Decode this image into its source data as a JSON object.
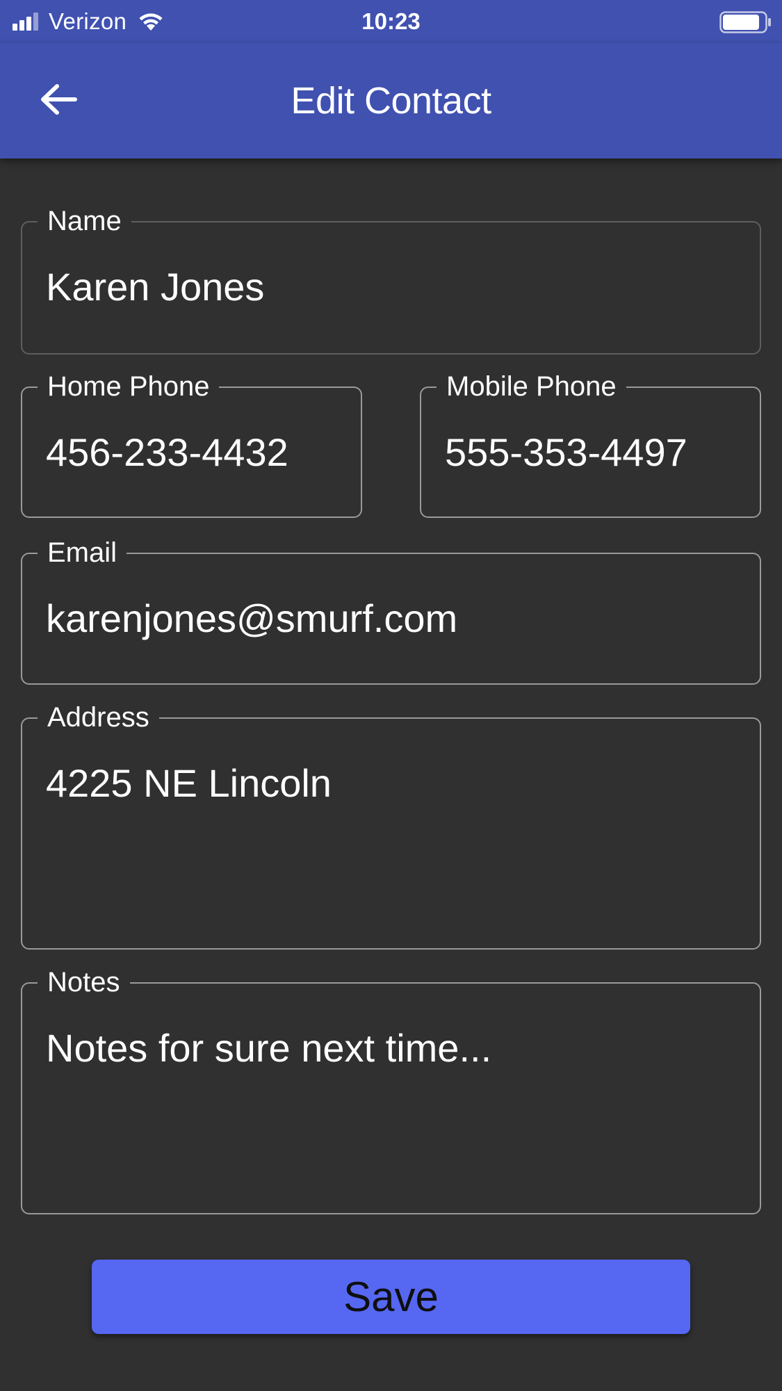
{
  "status_bar": {
    "carrier": "Verizon",
    "time": "10:23",
    "icons": [
      "signal-icon",
      "wifi-icon",
      "battery-icon"
    ]
  },
  "app_bar": {
    "title": "Edit Contact",
    "back_icon": "arrow-left-icon",
    "background": "#4051b0"
  },
  "form": {
    "name": {
      "label": "Name",
      "value": "Karen Jones"
    },
    "home_phone": {
      "label": "Home Phone",
      "value": "456-233-4432"
    },
    "mobile_phone": {
      "label": "Mobile Phone",
      "value": "555-353-4497"
    },
    "email": {
      "label": "Email",
      "value": "karenjones@smurf.com"
    },
    "address": {
      "label": "Address",
      "value": "4225 NE Lincoln"
    },
    "notes": {
      "label": "Notes",
      "value": "Notes for sure next time..."
    }
  },
  "actions": {
    "save_label": "Save",
    "save_color": "#5667f2"
  },
  "colors": {
    "page_background": "#303030",
    "field_border": "#9a9a9a"
  }
}
